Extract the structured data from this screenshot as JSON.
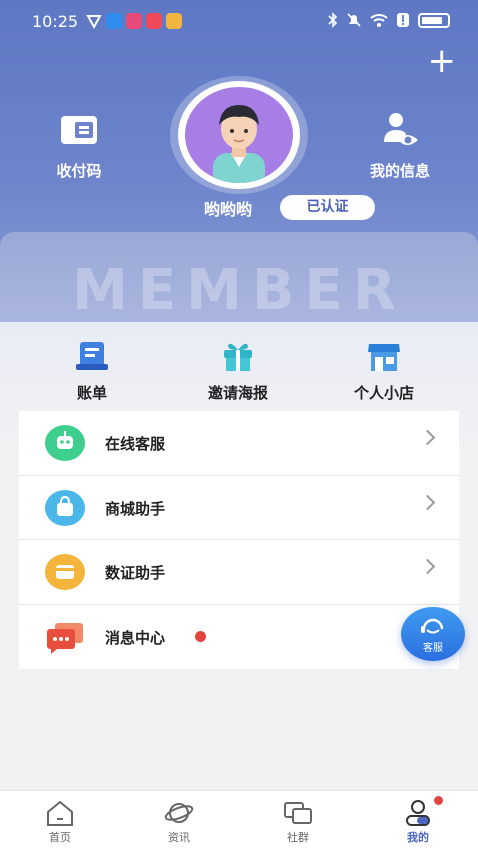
{
  "status_bar": {
    "time": "10:25"
  },
  "header": {
    "plus_label": "+",
    "pay_code_label": "收付码",
    "my_info_label": "我的信息",
    "username": "哟哟哟",
    "verified_badge": "已认证",
    "member_watermark": "MEMBER",
    "colors": {
      "header_start": "#5f78c4",
      "header_end": "#8b9dd6",
      "accent": "#4a66c2"
    }
  },
  "quick_actions": [
    {
      "label": "账单",
      "icon": "bill-icon"
    },
    {
      "label": "邀请海报",
      "icon": "gift-icon"
    },
    {
      "label": "个人小店",
      "icon": "shop-icon"
    }
  ],
  "menu": [
    {
      "label": "在线客服",
      "icon": "robot-icon",
      "color": "#3ecf8e",
      "has_chevron": true
    },
    {
      "label": "商城助手",
      "icon": "bag-icon",
      "color": "#4bb7e8",
      "has_chevron": true
    },
    {
      "label": "数证助手",
      "icon": "card-icon",
      "color": "#f5b43c",
      "has_chevron": true
    },
    {
      "label": "消息中心",
      "icon": "message-icon",
      "color": "#ef6a50",
      "has_chevron": false,
      "unread": true
    }
  ],
  "floating": {
    "customer_service_label": "客服"
  },
  "bottom_nav": [
    {
      "label": "首页",
      "icon": "home-icon"
    },
    {
      "label": "资讯",
      "icon": "planet-icon"
    },
    {
      "label": "社群",
      "icon": "chat-icon"
    },
    {
      "label": "我的",
      "icon": "profile-icon",
      "active": true
    }
  ]
}
